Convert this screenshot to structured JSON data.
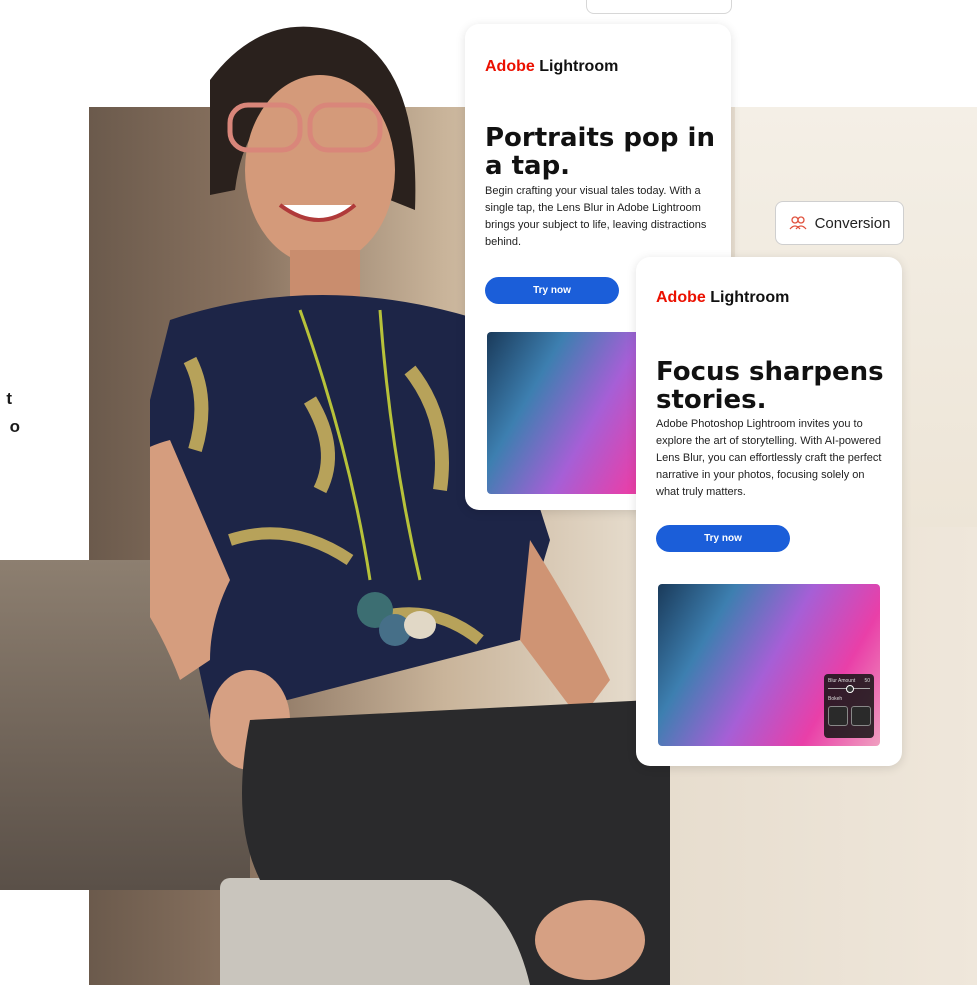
{
  "left_text": {
    "line1": "t",
    "line2": "o"
  },
  "card1": {
    "brand_adobe": "Adobe",
    "brand_product": "Lightroom",
    "headline": "Portraits pop in a tap.",
    "body": "Begin crafting your visual tales today. With a single tap, the Lens Blur in Adobe Lightroom brings your subject to life, leaving distractions behind.",
    "cta": "Try now"
  },
  "card2": {
    "brand_adobe": "Adobe",
    "brand_product": "Lightroom",
    "headline": "Focus sharpens stories.",
    "body": "Adobe Photoshop Lightroom invites you to explore the art of storytelling. With AI-powered Lens Blur, you can effortlessly craft the perfect narrative in your photos, focusing solely on what truly matters.",
    "cta": "Try now",
    "panel": {
      "label": "Blur Amount",
      "value": "50",
      "sublabel": "Bokeh"
    }
  },
  "badge": {
    "label": "Conversion",
    "icon": "people-icon"
  },
  "colors": {
    "adobe_red": "#eb1000",
    "cta_blue": "#1b5ed9"
  }
}
